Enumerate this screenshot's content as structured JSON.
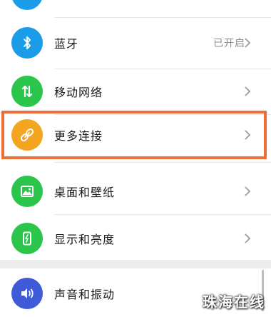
{
  "settings": {
    "items": [
      {
        "icon": "top-partial-icon",
        "label": "",
        "value": ""
      },
      {
        "icon": "bluetooth-icon",
        "label": "蓝牙",
        "value": "已开启"
      },
      {
        "icon": "mobile-network-icon",
        "label": "移动网络",
        "value": ""
      },
      {
        "icon": "link-icon",
        "label": "更多连接",
        "value": ""
      },
      {
        "icon": "wallpaper-icon",
        "label": "桌面和壁纸",
        "value": ""
      },
      {
        "icon": "display-brightness-icon",
        "label": "显示和亮度",
        "value": ""
      },
      {
        "icon": "sound-vibration-icon",
        "label": "声音和振动",
        "value": ""
      }
    ]
  },
  "colors": {
    "accent_blue": "#1a9ce8",
    "accent_green": "#2cc54b",
    "accent_orange": "#f4a51f",
    "highlight_border": "#ee6e3a",
    "sound_purple": "#3f5bd8"
  },
  "watermark": "珠海在线"
}
